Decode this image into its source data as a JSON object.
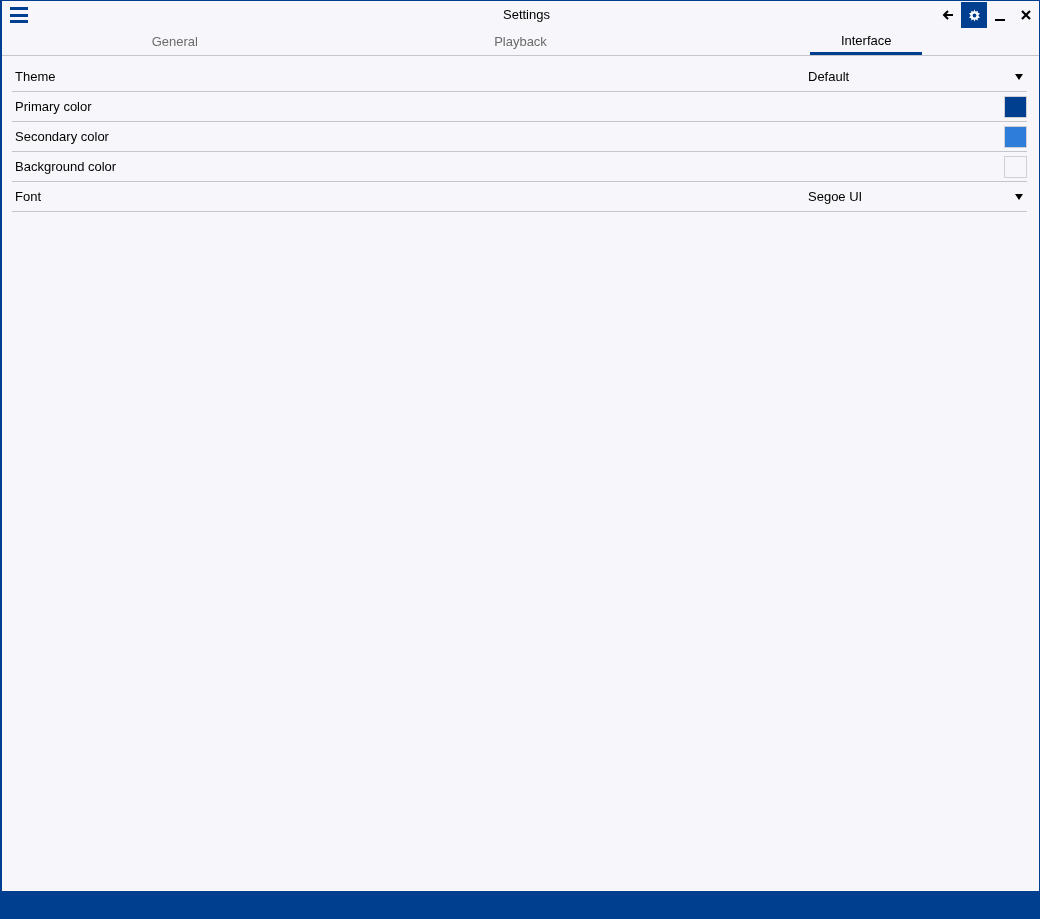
{
  "window": {
    "title": "Settings"
  },
  "tabs": [
    {
      "label": "General",
      "selected": false
    },
    {
      "label": "Playback",
      "selected": false
    },
    {
      "label": "Interface",
      "selected": true
    }
  ],
  "settings": [
    {
      "kind": "dropdown",
      "label": "Theme",
      "value": "Default"
    },
    {
      "kind": "color",
      "label": "Primary color",
      "color": "#003f8f"
    },
    {
      "kind": "color",
      "label": "Secondary color",
      "color": "#2e7ddb"
    },
    {
      "kind": "color",
      "label": "Background color",
      "color": "#f7f6fb"
    },
    {
      "kind": "dropdown",
      "label": "Font",
      "value": "Segoe UI"
    }
  ]
}
